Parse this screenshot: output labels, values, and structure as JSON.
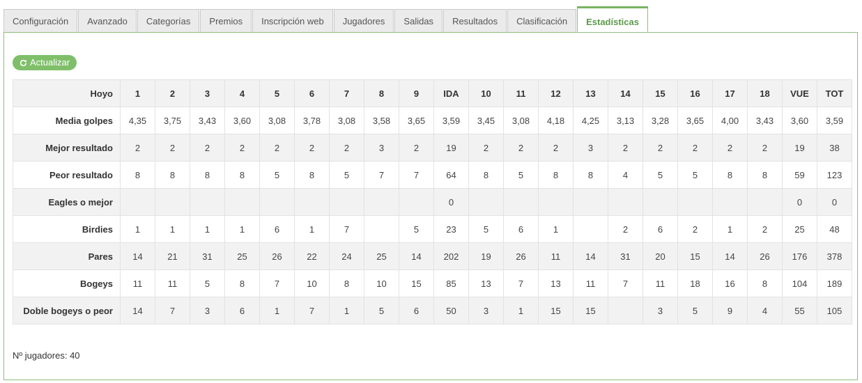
{
  "tabs": [
    {
      "label": "Configuración",
      "active": false
    },
    {
      "label": "Avanzado",
      "active": false
    },
    {
      "label": "Categorías",
      "active": false
    },
    {
      "label": "Premios",
      "active": false
    },
    {
      "label": "Inscripción web",
      "active": false
    },
    {
      "label": "Jugadores",
      "active": false
    },
    {
      "label": "Salidas",
      "active": false
    },
    {
      "label": "Resultados",
      "active": false
    },
    {
      "label": "Clasificación",
      "active": false
    },
    {
      "label": "Estadísticas",
      "active": true
    }
  ],
  "refresh_button": {
    "label": "Actualizar",
    "icon": "refresh-icon"
  },
  "colors": {
    "accent": "#78b360",
    "button": "#7fbf6a",
    "active_tab_text": "#5b9a4a"
  },
  "table": {
    "header_label": "Hoyo",
    "columns": [
      "1",
      "2",
      "3",
      "4",
      "5",
      "6",
      "7",
      "8",
      "9",
      "IDA",
      "10",
      "11",
      "12",
      "13",
      "14",
      "15",
      "16",
      "17",
      "18",
      "VUE",
      "TOT"
    ],
    "rows": [
      {
        "label": "Media golpes",
        "values": [
          "4,35",
          "3,75",
          "3,43",
          "3,60",
          "3,08",
          "3,78",
          "3,08",
          "3,58",
          "3,65",
          "3,59",
          "3,45",
          "3,08",
          "4,18",
          "4,25",
          "3,13",
          "3,28",
          "3,65",
          "4,00",
          "3,43",
          "3,60",
          "3,59"
        ]
      },
      {
        "label": "Mejor resultado",
        "values": [
          "2",
          "2",
          "2",
          "2",
          "2",
          "2",
          "2",
          "3",
          "2",
          "19",
          "2",
          "2",
          "2",
          "3",
          "2",
          "2",
          "2",
          "2",
          "2",
          "19",
          "38"
        ]
      },
      {
        "label": "Peor resultado",
        "values": [
          "8",
          "8",
          "8",
          "8",
          "5",
          "8",
          "5",
          "7",
          "7",
          "64",
          "8",
          "5",
          "8",
          "8",
          "4",
          "5",
          "5",
          "8",
          "8",
          "59",
          "123"
        ]
      },
      {
        "label": "Eagles o mejor",
        "values": [
          "",
          "",
          "",
          "",
          "",
          "",
          "",
          "",
          "",
          "0",
          "",
          "",
          "",
          "",
          "",
          "",
          "",
          "",
          "",
          "0",
          "0"
        ]
      },
      {
        "label": "Birdies",
        "values": [
          "1",
          "1",
          "1",
          "1",
          "6",
          "1",
          "7",
          "",
          "5",
          "23",
          "5",
          "6",
          "1",
          "",
          "2",
          "6",
          "2",
          "1",
          "2",
          "25",
          "48"
        ]
      },
      {
        "label": "Pares",
        "values": [
          "14",
          "21",
          "31",
          "25",
          "26",
          "22",
          "24",
          "25",
          "14",
          "202",
          "19",
          "26",
          "11",
          "14",
          "31",
          "20",
          "15",
          "14",
          "26",
          "176",
          "378"
        ]
      },
      {
        "label": "Bogeys",
        "values": [
          "11",
          "11",
          "5",
          "8",
          "7",
          "10",
          "8",
          "10",
          "15",
          "85",
          "13",
          "7",
          "13",
          "11",
          "7",
          "11",
          "18",
          "16",
          "8",
          "104",
          "189"
        ]
      },
      {
        "label": "Doble bogeys o peor",
        "values": [
          "14",
          "7",
          "3",
          "6",
          "1",
          "7",
          "1",
          "5",
          "6",
          "50",
          "3",
          "1",
          "15",
          "15",
          "",
          "3",
          "5",
          "9",
          "4",
          "55",
          "105"
        ]
      }
    ]
  },
  "players_count": "Nº jugadores: 40"
}
